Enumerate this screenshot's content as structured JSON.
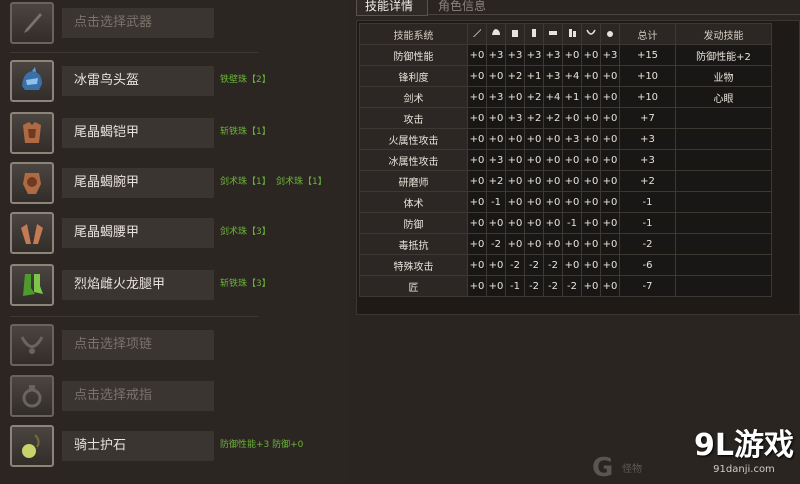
{
  "tabs": {
    "skill_details": "技能详情",
    "character_info": "角色信息"
  },
  "equipment": [
    {
      "name": "点击选择武器",
      "empty": true,
      "icon": "sword-icon",
      "gems": []
    },
    {
      "name": "冰雷鸟头盔",
      "empty": false,
      "icon": "helmet-icon",
      "gems": [
        "铁壁珠【2】"
      ]
    },
    {
      "name": "尾晶蝎铠甲",
      "empty": false,
      "icon": "chest-armor-icon",
      "gems": [
        "斩铁珠【1】"
      ]
    },
    {
      "name": "尾晶蝎腕甲",
      "empty": false,
      "icon": "arm-armor-icon",
      "gems": [
        "剑术珠【1】",
        "剑术珠【1】"
      ]
    },
    {
      "name": "尾晶蝎腰甲",
      "empty": false,
      "icon": "waist-armor-icon",
      "gems": [
        "剑术珠【3】"
      ]
    },
    {
      "name": "烈焰雌火龙腿甲",
      "empty": false,
      "icon": "leg-armor-icon",
      "gems": [
        "斩铁珠【3】"
      ]
    },
    {
      "name": "点击选择项链",
      "empty": true,
      "icon": "necklace-icon",
      "gems": []
    },
    {
      "name": "点击选择戒指",
      "empty": true,
      "icon": "ring-icon",
      "gems": []
    },
    {
      "name": "骑士护石",
      "empty": false,
      "icon": "talisman-icon",
      "gems": [
        "防御性能+3 防御+0"
      ]
    }
  ],
  "table": {
    "headers": {
      "skill_system": "技能系统",
      "total": "总计",
      "activated": "发动技能",
      "column_icons": [
        "weapon-col-icon",
        "helmet-col-icon",
        "chest-col-icon",
        "arm-col-icon",
        "waist-col-icon",
        "leg-col-icon",
        "necklace-col-icon",
        "talisman-col-icon"
      ]
    },
    "rows": [
      {
        "skill": "防御性能",
        "values": [
          "+0",
          "+3",
          "+3",
          "+3",
          "+3",
          "+0",
          "+0",
          "+3"
        ],
        "total": "+15",
        "activated": "防御性能+2"
      },
      {
        "skill": "锋利度",
        "values": [
          "+0",
          "+0",
          "+2",
          "+1",
          "+3",
          "+4",
          "+0",
          "+0"
        ],
        "total": "+10",
        "activated": "业物"
      },
      {
        "skill": "剑术",
        "values": [
          "+0",
          "+3",
          "+0",
          "+2",
          "+4",
          "+1",
          "+0",
          "+0"
        ],
        "total": "+10",
        "activated": "心眼"
      },
      {
        "skill": "攻击",
        "values": [
          "+0",
          "+0",
          "+3",
          "+2",
          "+2",
          "+0",
          "+0",
          "+0"
        ],
        "total": "+7",
        "activated": ""
      },
      {
        "skill": "火属性攻击",
        "values": [
          "+0",
          "+0",
          "+0",
          "+0",
          "+0",
          "+3",
          "+0",
          "+0"
        ],
        "total": "+3",
        "activated": ""
      },
      {
        "skill": "冰属性攻击",
        "values": [
          "+0",
          "+3",
          "+0",
          "+0",
          "+0",
          "+0",
          "+0",
          "+0"
        ],
        "total": "+3",
        "activated": ""
      },
      {
        "skill": "研磨师",
        "values": [
          "+0",
          "+2",
          "+0",
          "+0",
          "+0",
          "+0",
          "+0",
          "+0"
        ],
        "total": "+2",
        "activated": ""
      },
      {
        "skill": "体术",
        "values": [
          "+0",
          "-1",
          "+0",
          "+0",
          "+0",
          "+0",
          "+0",
          "+0"
        ],
        "total": "-1",
        "activated": ""
      },
      {
        "skill": "防御",
        "values": [
          "+0",
          "+0",
          "+0",
          "+0",
          "+0",
          "-1",
          "+0",
          "+0"
        ],
        "total": "-1",
        "activated": ""
      },
      {
        "skill": "毒抵抗",
        "values": [
          "+0",
          "-2",
          "+0",
          "+0",
          "+0",
          "+0",
          "+0",
          "+0"
        ],
        "total": "-2",
        "activated": ""
      },
      {
        "skill": "特殊攻击",
        "values": [
          "+0",
          "+0",
          "-2",
          "-2",
          "-2",
          "+0",
          "+0",
          "+0"
        ],
        "total": "-6",
        "activated": ""
      },
      {
        "skill": "匠",
        "values": [
          "+0",
          "+0",
          "-1",
          "-2",
          "-2",
          "-2",
          "+0",
          "+0"
        ],
        "total": "-7",
        "activated": ""
      }
    ]
  },
  "watermark": {
    "brand_main": "9L游戏",
    "brand_sub": "91danji.com",
    "logo_text": "怪物",
    "logo_letter": "G"
  },
  "colors": {
    "gem_text": "#6cb33b",
    "panel": "#2b2622",
    "table_bg": "#1d1a18"
  }
}
